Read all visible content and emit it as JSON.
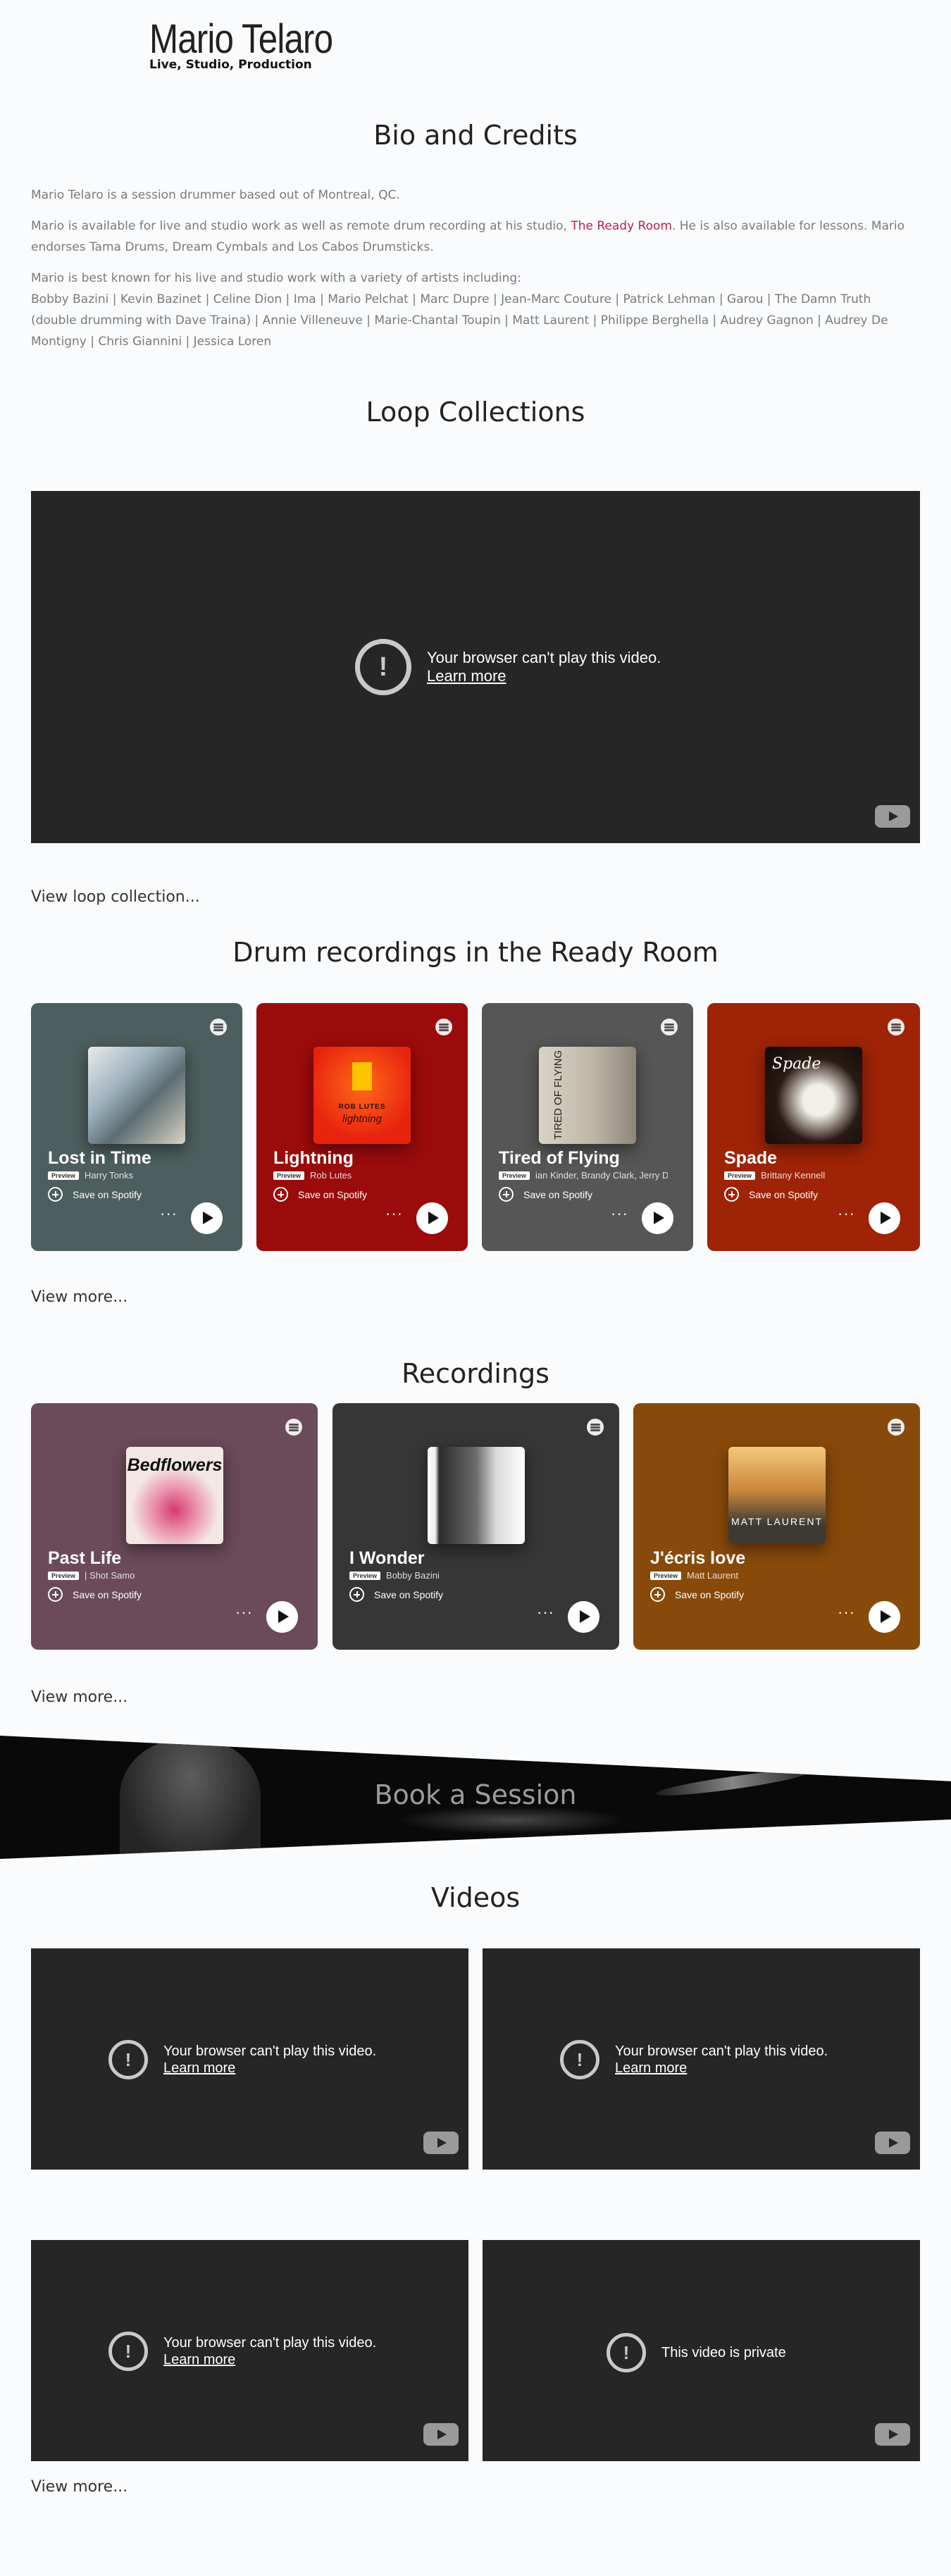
{
  "logo": {
    "name": "Mario Telaro",
    "tagline": "Live, Studio, Production"
  },
  "bio": {
    "heading": "Bio and Credits",
    "p1": "Mario Telaro is a session drummer based out of Montreal, QC.",
    "p2_before": "Mario is available for live and studio work as well as remote drum recording at his studio, ",
    "p2_link": "The Ready Room",
    "p2_after": ". He is also available for lessons. Mario endorses Tama Drums, Dream Cymbals and Los Cabos Drumsticks.",
    "p3_intro": "Mario is best known for his live and studio work with a variety of artists including:",
    "p3_artists": "Bobby Bazini | Kevin Bazinet | Celine Dion | Ima | Mario Pelchat | Marc Dupre | Jean-Marc Couture | Patrick Lehman | Garou | The Damn Truth (double drumming with Dave Traina) | Annie Villeneuve | Marie-Chantal Toupin | Matt Laurent | Philippe Berghella | Audrey Gagnon | Audrey De Montigny | Chris Giannini | Jessica Loren"
  },
  "loops": {
    "heading": "Loop Collections",
    "video": {
      "message": "Your browser can't play this video.",
      "learn": "Learn more"
    },
    "more": "View loop collection..."
  },
  "ready_room": {
    "heading": "Drum recordings in the Ready Room",
    "cards": [
      {
        "title": "Lost in Time",
        "artist": "Harry Tonks",
        "color": "#4c5e5d"
      },
      {
        "title": "Lightning",
        "artist": "Rob Lutes",
        "color": "#9b0b0b"
      },
      {
        "title": "Tired of Flying",
        "artist": "ian Kinder, Brandy Clark, Jerry D",
        "color": "#565656"
      },
      {
        "title": "Spade",
        "artist": "Brittany Kennell",
        "color": "#9e2307"
      }
    ],
    "more": "View more..."
  },
  "recordings": {
    "heading": "Recordings",
    "cards": [
      {
        "title": "Past Life",
        "artist": "| Shot Samo",
        "color": "#6b4a5a"
      },
      {
        "title": "I Wonder",
        "artist": "Bobby Bazini",
        "color": "#363636"
      },
      {
        "title": "J'écris love",
        "artist": "Matt Laurent",
        "color": "#884a0a"
      }
    ],
    "more": "View more..."
  },
  "card_common": {
    "preview": "Preview",
    "save": "Save on Spotify",
    "dots": "···"
  },
  "cover_art": {
    "lightning": "ROB LUTES",
    "lightning_script": "lightning",
    "tired": "TIRED OF FLYING",
    "spade": "Spade",
    "bedflowers": "Bedflowers",
    "mattlaurent": "MATT LAURENT"
  },
  "banner": {
    "text": "Book a Session"
  },
  "videos": {
    "heading": "Videos",
    "items": [
      {
        "message": "Your browser can't play this video.",
        "learn": "Learn more"
      },
      {
        "message": "Your browser can't play this video.",
        "learn": "Learn more"
      },
      {
        "message": "Your browser can't play this video.",
        "learn": "Learn more"
      },
      {
        "message": "This video is private",
        "learn": ""
      }
    ],
    "more": "View more..."
  },
  "colors": {
    "accent_link": "#b3234a",
    "video_bg": "#262626"
  }
}
